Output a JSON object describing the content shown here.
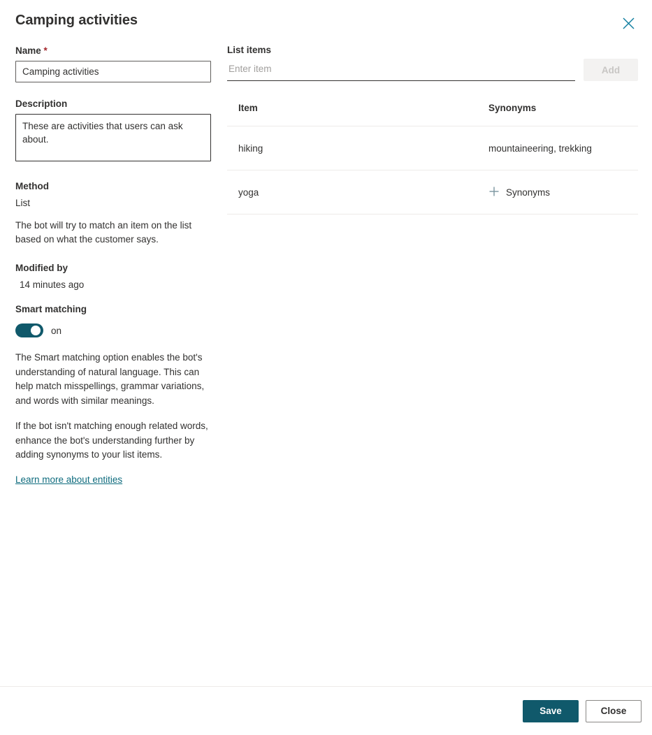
{
  "header": {
    "title": "Camping activities",
    "close_icon": "close-icon"
  },
  "left": {
    "name": {
      "label": "Name",
      "required_marker": "*",
      "value": "Camping activities"
    },
    "description": {
      "label": "Description",
      "value": "These are activities that users can ask about."
    },
    "method": {
      "label": "Method",
      "value": "List",
      "help": "The bot will try to match an item on the list based on what the customer says."
    },
    "modified": {
      "label": "Modified by",
      "value": "14 minutes ago"
    },
    "smart_matching": {
      "label": "Smart matching",
      "toggle_state": "on",
      "toggle_on": true,
      "paragraph_1": "The Smart matching option enables the bot's understanding of natural language. This can help match misspellings, grammar variations, and words with similar meanings.",
      "paragraph_2": "If the bot isn't matching enough related words, enhance the bot's understanding further by adding synonyms to your list items.",
      "link_text": "Learn more about entities"
    }
  },
  "right": {
    "list_items_label": "List items",
    "item_input_placeholder": "Enter item",
    "item_input_value": "",
    "add_button_label": "Add",
    "add_button_disabled": true,
    "table": {
      "columns": [
        "Item",
        "Synonyms"
      ],
      "rows": [
        {
          "item": "hiking",
          "synonyms": "mountaineering, trekking",
          "has_synonyms": true
        },
        {
          "item": "yoga",
          "synonyms": "Synonyms",
          "has_synonyms": false
        }
      ]
    }
  },
  "footer": {
    "save_label": "Save",
    "close_label": "Close"
  },
  "colors": {
    "accent": "#10596b",
    "link": "#0f6c7e",
    "required": "#a4262c",
    "plus_icon": "#7a959f",
    "divider": "#edebe9"
  }
}
